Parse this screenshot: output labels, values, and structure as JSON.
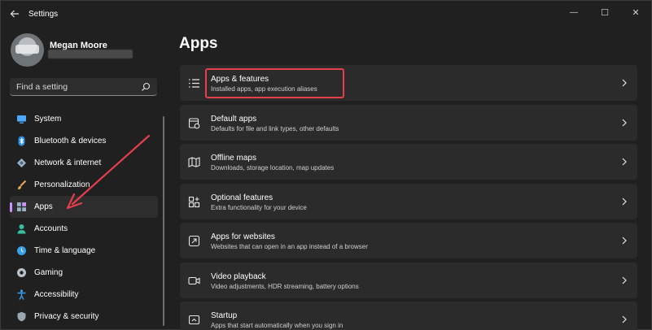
{
  "window": {
    "title": "Settings",
    "controls": {
      "minimize": "—",
      "maximize": "☐",
      "close": "✕"
    }
  },
  "profile": {
    "name": "Megan Moore",
    "email": ""
  },
  "search": {
    "placeholder": "Find a setting"
  },
  "sidebar": {
    "items": [
      {
        "label": "System",
        "icon": "monitor-icon",
        "color": "#4ea8ff"
      },
      {
        "label": "Bluetooth & devices",
        "icon": "bluetooth-icon",
        "color": "#2b8fe6"
      },
      {
        "label": "Network & internet",
        "icon": "wifi-diamond-icon",
        "color": "#9fb5c9"
      },
      {
        "label": "Personalization",
        "icon": "brush-icon",
        "color": "#e4a95c"
      },
      {
        "label": "Apps",
        "icon": "apps-icon",
        "color": "#9ab0c4",
        "active": true
      },
      {
        "label": "Accounts",
        "icon": "person-icon",
        "color": "#37c0a0"
      },
      {
        "label": "Time & language",
        "icon": "globe-clock-icon",
        "color": "#3aa0e8"
      },
      {
        "label": "Gaming",
        "icon": "controller-icon",
        "color": "#b9c3cc"
      },
      {
        "label": "Accessibility",
        "icon": "accessibility-icon",
        "color": "#3a9be8"
      },
      {
        "label": "Privacy & security",
        "icon": "shield-icon",
        "color": "#9aa6b2"
      }
    ]
  },
  "main": {
    "title": "Apps",
    "cards": [
      {
        "title": "Apps & features",
        "subtitle": "Installed apps, app execution aliases",
        "icon": "list-icon",
        "highlighted": true
      },
      {
        "title": "Default apps",
        "subtitle": "Defaults for file and link types, other defaults",
        "icon": "default-apps-icon"
      },
      {
        "title": "Offline maps",
        "subtitle": "Downloads, storage location, map updates",
        "icon": "map-icon"
      },
      {
        "title": "Optional features",
        "subtitle": "Extra functionality for your device",
        "icon": "grid-plus-icon"
      },
      {
        "title": "Apps for websites",
        "subtitle": "Websites that can open in an app instead of a browser",
        "icon": "open-link-icon"
      },
      {
        "title": "Video playback",
        "subtitle": "Video adjustments, HDR streaming, battery options",
        "icon": "video-icon"
      },
      {
        "title": "Startup",
        "subtitle": "Apps that start automatically when you sign in",
        "icon": "startup-icon"
      }
    ]
  },
  "colors": {
    "accent": "#c894ff",
    "annotation": "#e53e4d",
    "background": "#202020",
    "card": "#2b2b2b"
  }
}
